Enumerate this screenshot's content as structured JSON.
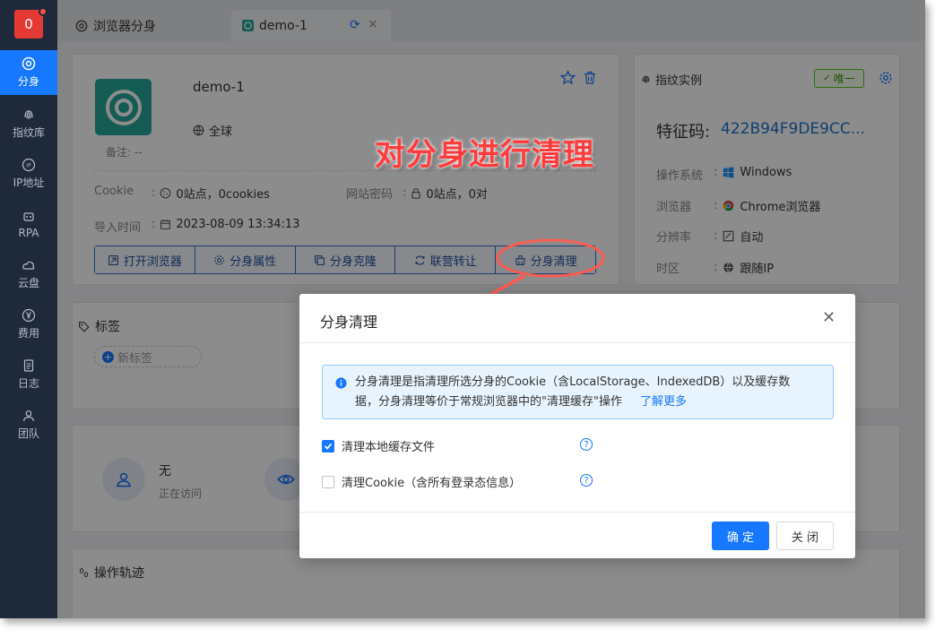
{
  "sidebar": {
    "badge": "0",
    "items": [
      {
        "label": "分身",
        "icon": "chrome-icon",
        "active": true
      },
      {
        "label": "指纹库",
        "icon": "fingerprint-icon"
      },
      {
        "label": "IP地址",
        "icon": "ip-icon"
      },
      {
        "label": "RPA",
        "icon": "robot-icon"
      },
      {
        "label": "云盘",
        "icon": "cloud-icon"
      },
      {
        "label": "费用",
        "icon": "yen-icon"
      },
      {
        "label": "日志",
        "icon": "document-icon"
      },
      {
        "label": "团队",
        "icon": "team-icon"
      }
    ]
  },
  "tabs": [
    {
      "label": "浏览器分身"
    },
    {
      "label": "demo-1"
    }
  ],
  "profile": {
    "name": "demo-1",
    "note": "备注: --",
    "region": "全球",
    "cookie_label": "Cookie",
    "cookie_value": "0站点，0cookies",
    "password_label": "网站密码",
    "password_value": "0站点，0对",
    "import_label": "导入时间",
    "import_value": "2023-08-09 13:34:13",
    "actions": [
      "打开浏览器",
      "分身属性",
      "分身克隆",
      "联营转让",
      "分身清理"
    ]
  },
  "fingerprint": {
    "title": "指纹实例",
    "badge": "唯一",
    "feature_label": "特征码:",
    "feature_value": "422B94F9DE9CC...",
    "rows": [
      {
        "label": "操作系统",
        "value": "Windows"
      },
      {
        "label": "浏览器",
        "value": "Chrome浏览器"
      },
      {
        "label": "分辨率",
        "value": "自动"
      },
      {
        "label": "时区",
        "value": "跟随IP"
      }
    ]
  },
  "tags": {
    "title": "标签",
    "new_tag": "新标签"
  },
  "stats": {
    "value": "无",
    "label": "正在访问"
  },
  "track": {
    "title": "操作轨迹"
  },
  "annotation": "对分身进行清理",
  "dialog": {
    "title": "分身清理",
    "info_line1": "分身清理是指清理所选分身的Cookie（含LocalStorage、IndexedDB）以及缓存数",
    "info_line2": "据，分身清理等价于常规浏览器中的\"清理缓存\"操作",
    "info_link": "了解更多",
    "option1": "清理本地缓存文件",
    "option1_checked": true,
    "option2": "清理Cookie（含所有登录态信息）",
    "option2_checked": false,
    "ok": "确 定",
    "cancel": "关 闭"
  },
  "colors": {
    "primary": "#1677ff",
    "annotation": "#ff3b3b",
    "sidebar": "#1e2a3a"
  }
}
